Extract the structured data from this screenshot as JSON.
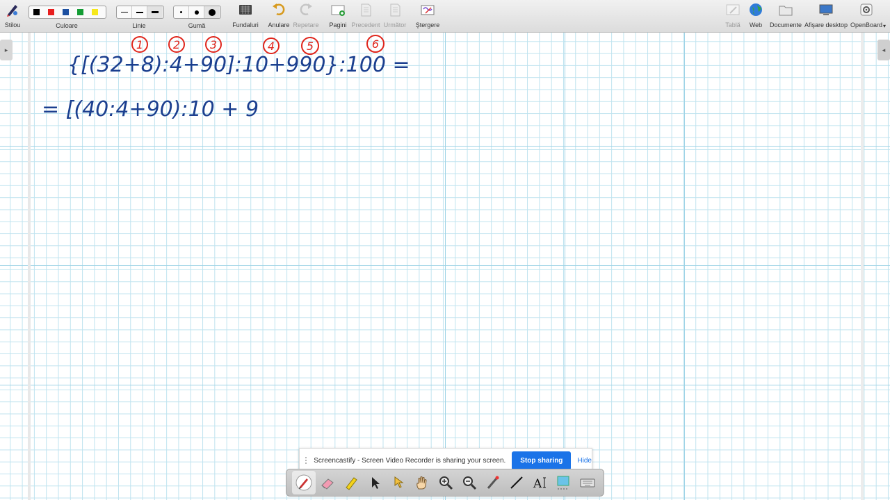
{
  "toolbar": {
    "pen": "Stilou",
    "color": "Culoare",
    "line": "Linie",
    "eraser": "Gumă",
    "backgrounds": "Fundaluri",
    "undo": "Anulare",
    "redo": "Repetare",
    "pages": "Pagini",
    "previous": "Precedent",
    "next": "Următor",
    "clear": "Ştergere",
    "board": "Tablă",
    "web": "Web",
    "documents": "Documente",
    "show_desktop": "Afişare desktop",
    "openboard": "OpenBoard"
  },
  "colors": [
    "#000000",
    "#e81f1f",
    "#1c4fa0",
    "#139c34",
    "#f6e81a"
  ],
  "board": {
    "line1": "{[(32+8):4+90]:10+990}:100 =",
    "line2": "= [(40:4+90):10 + 9",
    "step_markers": [
      "1",
      "2",
      "3",
      "4",
      "5",
      "6"
    ],
    "ink_color": "#1b3f8f",
    "marker_color": "#e0251b"
  },
  "share": {
    "message": "Screencastify - Screen Video Recorder is sharing your screen.",
    "stop_button": "Stop sharing",
    "hide": "Hide"
  },
  "palette": {
    "tools": [
      "pen-tool-icon",
      "eraser-tool-icon",
      "highlighter-tool-icon",
      "pointer-tool-icon",
      "pointer-hand-tool-icon",
      "hand-tool-icon",
      "zoom-in-tool-icon",
      "zoom-out-tool-icon",
      "laser-pointer-tool-icon",
      "line-tool-icon",
      "text-tool-icon",
      "capture-tool-icon",
      "keyboard-tool-icon"
    ]
  }
}
